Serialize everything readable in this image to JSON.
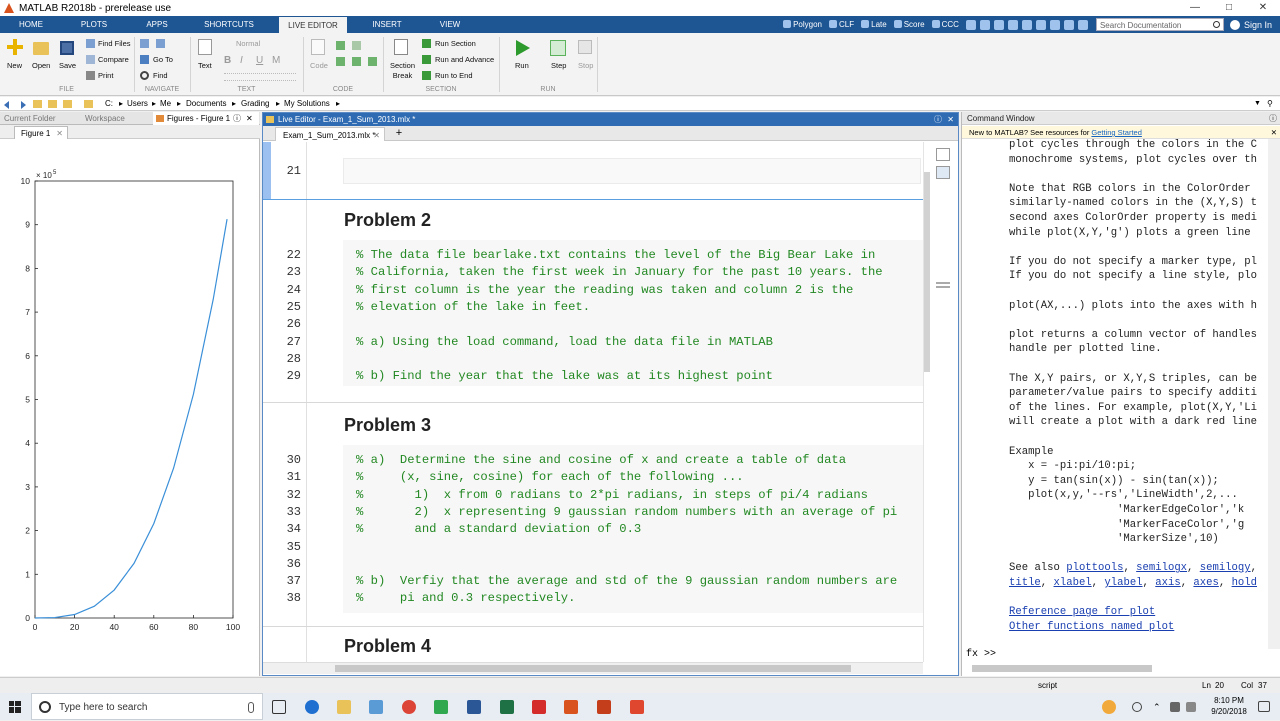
{
  "window": {
    "title": "MATLAB R2018b - prerelease use"
  },
  "ribbon": {
    "tabs": [
      "HOME",
      "PLOTS",
      "APPS",
      "SHORTCUTS",
      "LIVE EDITOR",
      "INSERT",
      "VIEW"
    ],
    "active_tab": "LIVE EDITOR",
    "quick_buttons": [
      "Polygon",
      "CLF",
      "Late",
      "Score",
      "CCC"
    ],
    "search_placeholder": "Search Documentation",
    "signin": "Sign In"
  },
  "toolstrip": {
    "file": {
      "new": "New",
      "open": "Open",
      "save": "Save",
      "find_files": "Find Files",
      "compare": "Compare",
      "print": "Print",
      "group": "FILE"
    },
    "navigate": {
      "goto": "Go To",
      "find": "Find",
      "group": "NAVIGATE"
    },
    "text": {
      "text": "Text",
      "style": "Normal",
      "group": "TEXT"
    },
    "code": {
      "code": "Code",
      "group": "CODE"
    },
    "section": {
      "section_break": "Section\nBreak",
      "run_section": "Run Section",
      "run_advance": "Run and Advance",
      "run_end": "Run to End",
      "group": "SECTION"
    },
    "run": {
      "run": "Run",
      "step": "Step",
      "stop": "Stop",
      "group": "RUN"
    }
  },
  "path": [
    "C:",
    "Users",
    "Me",
    "Documents",
    "Grading",
    "My Solutions"
  ],
  "left_panel": {
    "tabs": [
      "Current Folder",
      "Workspace",
      "Figures - Figure 1"
    ],
    "figure_tab": "Figure 1",
    "plot": {
      "x_ticks": [
        "0",
        "20",
        "40",
        "60",
        "80",
        "100"
      ],
      "y_ticks": [
        "0",
        "1",
        "2",
        "3",
        "4",
        "5",
        "6",
        "7",
        "8",
        "9",
        "10"
      ],
      "exponent": "× 10",
      "exponent_power": "5"
    }
  },
  "chart_data": {
    "type": "line",
    "title": "",
    "xlabel": "",
    "ylabel": "",
    "xlim": [
      0,
      100
    ],
    "ylim": [
      0,
      1000000
    ],
    "series": [
      {
        "x": [
          0,
          10,
          20,
          30,
          40,
          50,
          60,
          70,
          80,
          90,
          97
        ],
        "y": [
          0,
          1000,
          8000,
          27000,
          64000,
          125000,
          216000,
          343000,
          512000,
          729000,
          912673
        ]
      }
    ]
  },
  "editor": {
    "title": "Live Editor - Exam_1_Sum_2013.mlx *",
    "tab": "Exam_1_Sum_2013.mlx *",
    "line21": "21",
    "problem2": {
      "heading": "Problem 2",
      "lines": [
        {
          "num": "22",
          "text": "% The data file bearlake.txt contains the level of the Big Bear Lake in"
        },
        {
          "num": "23",
          "text": "% California, taken the first week in January for the past 10 years. the"
        },
        {
          "num": "24",
          "text": "% first column is the year the reading was taken and column 2 is the"
        },
        {
          "num": "25",
          "text": "% elevation of the lake in feet."
        },
        {
          "num": "26",
          "text": ""
        },
        {
          "num": "27",
          "text": "% a) Using the load command, load the data file in MATLAB"
        },
        {
          "num": "28",
          "text": ""
        },
        {
          "num": "29",
          "text": "% b) Find the year that the lake was at its highest point"
        }
      ]
    },
    "problem3": {
      "heading": "Problem 3",
      "lines": [
        {
          "num": "30",
          "text": "% a)  Determine the sine and cosine of x and create a table of data"
        },
        {
          "num": "31",
          "text": "%     (x, sine, cosine) for each of the following ..."
        },
        {
          "num": "32",
          "text": "%       1)  x from 0 radians to 2*pi radians, in steps of pi/4 radians"
        },
        {
          "num": "33",
          "text": "%       2)  x representing 9 gaussian random numbers with an average of pi"
        },
        {
          "num": "34",
          "text": "%       and a standard deviation of 0.3"
        },
        {
          "num": "35",
          "text": ""
        },
        {
          "num": "36",
          "text": ""
        },
        {
          "num": "37",
          "text": "% b)  Verfiy that the average and std of the 9 gaussian random numbers are"
        },
        {
          "num": "38",
          "text": "%     pi and 0.3 respectively."
        }
      ]
    },
    "problem4": {
      "heading": "Problem 4"
    }
  },
  "command_window": {
    "title": "Command Window",
    "new_prefix": "New to MATLAB? See resources for ",
    "new_link": "Getting Started",
    "lines": [
      "plot cycles through the colors in the C",
      "monochrome systems, plot cycles over th",
      "",
      "Note that RGB colors in the ColorOrder",
      "similarly-named colors in the (X,Y,S) t",
      "second axes ColorOrder property is medi",
      "while plot(X,Y,'g') plots a green line",
      "",
      "If you do not specify a marker type, pl",
      "If you do not specify a line style, plo",
      "",
      "plot(AX,...) plots into the axes with h",
      "",
      "plot returns a column vector of handles",
      "handle per plotted line.",
      "",
      "The X,Y pairs, or X,Y,S triples, can be",
      "parameter/value pairs to specify additi",
      "of the lines. For example, plot(X,Y,'Li",
      "will create a plot with a dark red line",
      "",
      "Example",
      "   x = -pi:pi/10:pi;",
      "   y = tan(sin(x)) - sin(tan(x));",
      "   plot(x,y,'--rs','LineWidth',2,...",
      "                 'MarkerEdgeColor','k",
      "                 'MarkerFaceColor','g",
      "                 'MarkerSize',10)",
      "",
      "See also plottools, semilogx, semilogy,",
      "title, xlabel, ylabel, axis, axes, hold",
      "",
      "Reference page for plot",
      "Other functions named plot"
    ],
    "prompt": "fx >>"
  },
  "statusbar": {
    "mode": "script",
    "ln_label": "Ln",
    "ln": "20",
    "col_label": "Col",
    "col": "37"
  },
  "taskbar": {
    "search_placeholder": "Type here to search",
    "time": "8:10 PM",
    "date": "9/20/2018"
  }
}
